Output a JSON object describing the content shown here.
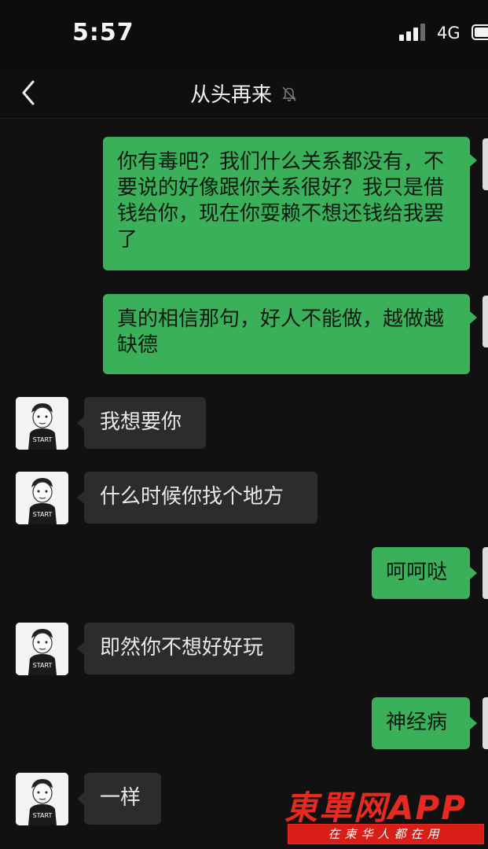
{
  "status_bar": {
    "time": "5:57",
    "network": "4G",
    "icons": [
      "signal-icon",
      "battery-icon"
    ]
  },
  "nav": {
    "title": "从头再来",
    "icons": [
      "back-chevron-icon",
      "mute-bell-icon"
    ]
  },
  "colors": {
    "outgoing_bubble": "#3bb05a",
    "incoming_bubble": "#2c2c2c",
    "background": "#111111",
    "watermark_red": "#e62a1f"
  },
  "messages": [
    {
      "from": "me",
      "text": "你有毒吧？我们什么关系都没有，不要说的好像跟你关系很好？我只是借钱给你，现在你耍赖不想还钱给我罢了"
    },
    {
      "from": "me",
      "text": "真的相信那句，好人不能做，越做越缺德"
    },
    {
      "from": "contact",
      "text": "我想要你"
    },
    {
      "from": "contact",
      "text": "什么时候你找个地方"
    },
    {
      "from": "me",
      "text": "呵呵哒"
    },
    {
      "from": "contact",
      "text": "即然你不想好好玩"
    },
    {
      "from": "me",
      "text": "神经病"
    },
    {
      "from": "contact",
      "text": "一样"
    }
  ],
  "avatar_text": "START",
  "watermark": {
    "title": "東單网APP",
    "subtitle": "在柬华人都在用"
  }
}
